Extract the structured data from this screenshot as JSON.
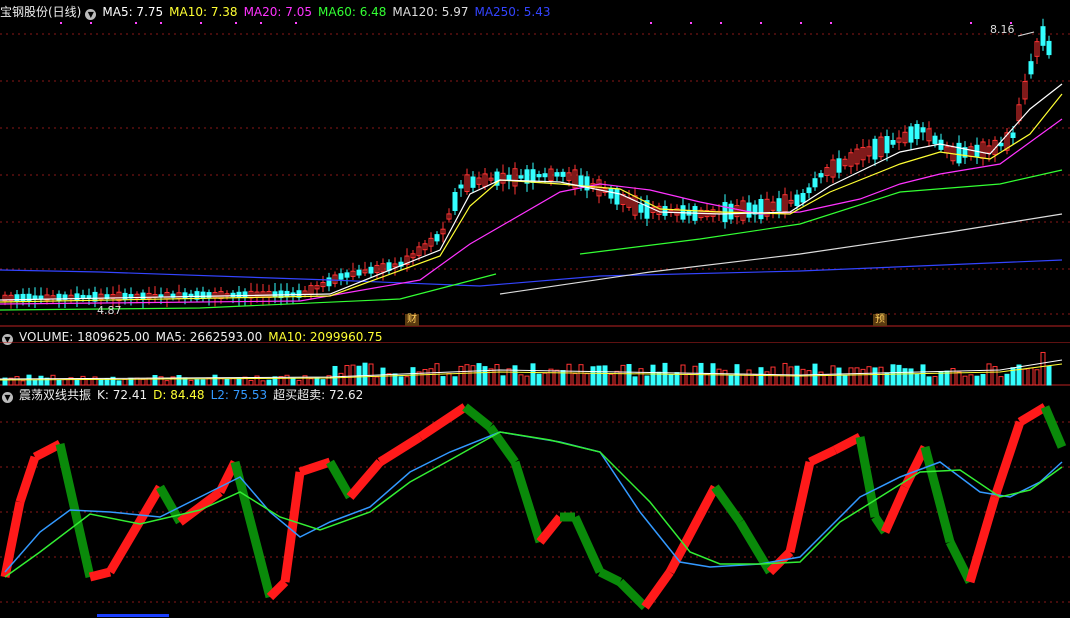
{
  "header": {
    "stock_name": "宝钢股份(日线)",
    "indicators": [
      {
        "label": "MA5: 7.75",
        "color": "#ffffff"
      },
      {
        "label": "MA10: 7.38",
        "color": "#ffff33"
      },
      {
        "label": "MA20: 7.05",
        "color": "#ff33ff"
      },
      {
        "label": "MA60: 6.48",
        "color": "#33ff33"
      },
      {
        "label": "MA120: 5.97",
        "color": "#dddddd"
      },
      {
        "label": "MA250: 5.43",
        "color": "#3344ff"
      }
    ]
  },
  "price_panel": {
    "max_label": "8.16",
    "min_label": "4.87",
    "badges": [
      "财",
      "预"
    ]
  },
  "volume_panel": {
    "label": "VOLUME: 1809625.00",
    "ma5": "MA5: 2662593.00",
    "ma10": "MA10: 2099960.75"
  },
  "oscillator_panel": {
    "name": "震荡双线共振",
    "k": "K: 72.41",
    "d": "D: 84.48",
    "l2": "L2: 75.53",
    "signal": "超买超卖: 72.62"
  },
  "colors": {
    "up": "#ff3333",
    "down": "#33ffff",
    "grid": "#8a1818",
    "osc_up": "#ff1a1a",
    "osc_down": "#0a8a0a",
    "line_blue": "#3399ff",
    "line_green": "#33ee33"
  }
}
